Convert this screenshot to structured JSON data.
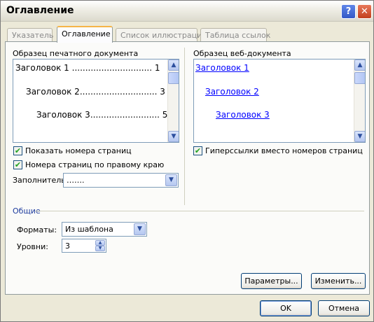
{
  "window": {
    "title": "Оглавление",
    "help_glyph": "?",
    "close_glyph": "✕"
  },
  "tabs": [
    {
      "label": "Указатель",
      "active": false
    },
    {
      "label": "Оглавление",
      "active": true
    },
    {
      "label": "Список иллюстраций",
      "active": false
    },
    {
      "label": "Таблица ссылок",
      "active": false
    }
  ],
  "print_preview": {
    "label": "Образец печатного документа",
    "lines": [
      "Заголовок 1 .............................. 1",
      "Заголовок 2............................. 3",
      "Заголовок 3.......................... 5"
    ]
  },
  "web_preview": {
    "label": "Образец веб-документа",
    "links": [
      "Заголовок 1",
      "Заголовок 2",
      "Заголовок 3"
    ]
  },
  "options": {
    "show_page_numbers": "Показать номера страниц",
    "right_align": "Номера страниц по правому краю",
    "hyperlinks": "Гиперссылки вместо номеров страниц",
    "filler_label": "Заполнитель:",
    "filler_value": "……."
  },
  "general": {
    "heading": "Общие",
    "formats_label": "Форматы:",
    "formats_value": "Из шаблона",
    "levels_label": "Уровни:",
    "levels_value": "3"
  },
  "buttons": {
    "parameters": "Параметры...",
    "modify": "Изменить...",
    "ok": "OK",
    "cancel": "Отмена"
  },
  "icons": {
    "check": "✔",
    "up": "▲",
    "down": "▼"
  }
}
